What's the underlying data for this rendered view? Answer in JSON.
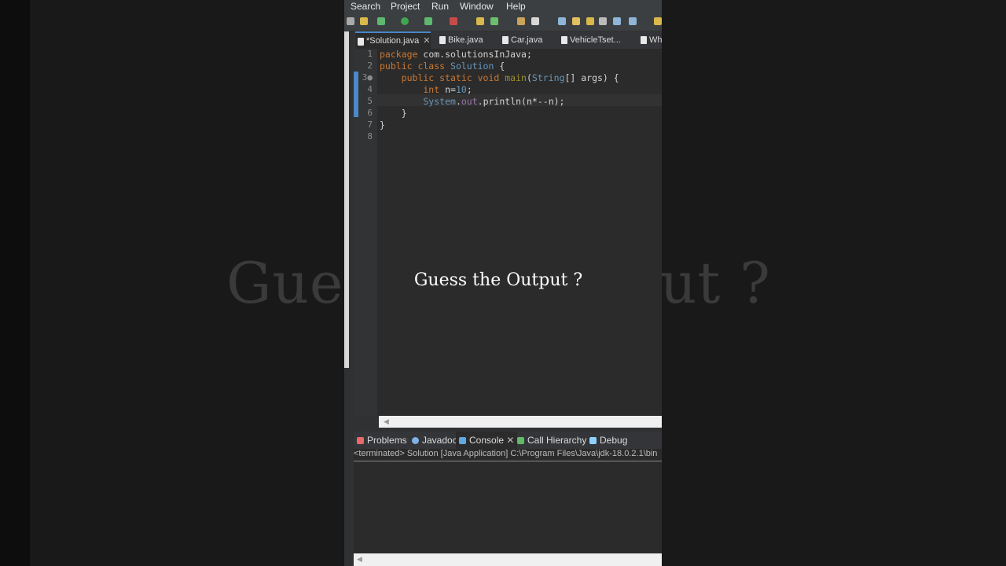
{
  "background": {
    "blur_text": "Guess the Output ?"
  },
  "menu": [
    "Search",
    "Project",
    "Run",
    "Window",
    "Help"
  ],
  "tabs": [
    {
      "label": "*Solution.java",
      "active": true,
      "close": "✕"
    },
    {
      "label": "Bike.java"
    },
    {
      "label": "Car.java"
    },
    {
      "label": "VehicleTset..."
    },
    {
      "label": "Wh"
    }
  ],
  "code": {
    "lines": [
      {
        "num": "1",
        "tokens": [
          {
            "t": "package ",
            "c": "#cc7832"
          },
          {
            "t": "com.solutionsInJava;",
            "c": "#d4d4d4"
          }
        ]
      },
      {
        "num": "2",
        "tokens": [
          {
            "t": "public class ",
            "c": "#cc7832"
          },
          {
            "t": "Solution ",
            "c": "#6897bb"
          },
          {
            "t": "{",
            "c": "#d4d4d4"
          }
        ]
      },
      {
        "num": "3●",
        "tokens": [
          {
            "t": "    public static void ",
            "c": "#cc7832"
          },
          {
            "t": "main",
            "c": "#9c8f2d"
          },
          {
            "t": "(",
            "c": "#d4d4d4"
          },
          {
            "t": "String",
            "c": "#6897bb"
          },
          {
            "t": "[] ",
            "c": "#d4d4d4"
          },
          {
            "t": "args",
            "c": "#d4d4d4"
          },
          {
            "t": ") {",
            "c": "#d4d4d4"
          }
        ]
      },
      {
        "num": "4",
        "tokens": [
          {
            "t": "        int ",
            "c": "#cc7832"
          },
          {
            "t": "n",
            "c": "#d4d4d4"
          },
          {
            "t": "=",
            "c": "#d4d4d4"
          },
          {
            "t": "10",
            "c": "#6897bb"
          },
          {
            "t": ";",
            "c": "#d4d4d4"
          }
        ]
      },
      {
        "num": "5",
        "tokens": [
          {
            "t": "        System",
            "c": "#6897bb"
          },
          {
            "t": ".",
            "c": "#d4d4d4"
          },
          {
            "t": "out",
            "c": "#9876aa"
          },
          {
            "t": ".println(",
            "c": "#d4d4d4"
          },
          {
            "t": "n",
            "c": "#d4d4d4"
          },
          {
            "t": "*--",
            "c": "#d4d4d4"
          },
          {
            "t": "n",
            "c": "#d4d4d4"
          },
          {
            "t": ");",
            "c": "#d4d4d4"
          }
        ]
      },
      {
        "num": "6",
        "tokens": [
          {
            "t": "    }",
            "c": "#d4d4d4"
          }
        ]
      },
      {
        "num": "7",
        "tokens": [
          {
            "t": "}",
            "c": "#d4d4d4"
          }
        ]
      },
      {
        "num": "8",
        "tokens": []
      }
    ]
  },
  "bottom_tabs": [
    {
      "label": "Problems",
      "icon_color": "#e86a6a"
    },
    {
      "label": "Javadoc",
      "icon_color": "#7fb2e5"
    },
    {
      "label": "Console",
      "active": true,
      "close": "✕",
      "icon_color": "#5fa8e0"
    },
    {
      "label": "Call Hierarchy",
      "icon_color": "#63b86a"
    },
    {
      "label": "Debug",
      "icon_color": "#8fd0ff"
    }
  ],
  "console_status": "<terminated> Solution [Java Application] C:\\Program Files\\Java\\jdk-18.0.2.1\\bin",
  "overlay_text": "Guess the Output ?",
  "scroll_arrow": "◀"
}
